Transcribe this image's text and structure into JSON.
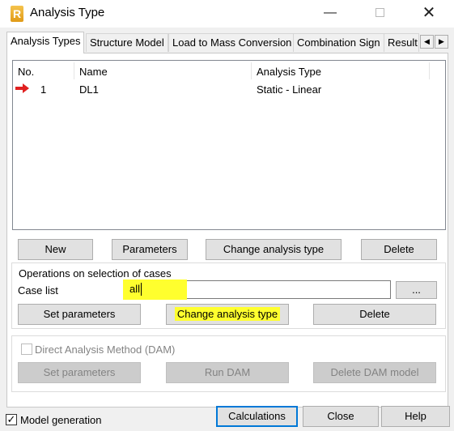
{
  "window": {
    "title": "Analysis Type",
    "app_icon_letter": "R",
    "minimize_glyph": "—",
    "close_glyph": "✕"
  },
  "tabs": [
    {
      "label": "Analysis Types",
      "active": true
    },
    {
      "label": "Structure Model",
      "active": false
    },
    {
      "label": "Load to Mass Conversion",
      "active": false
    },
    {
      "label": "Combination Sign",
      "active": false
    },
    {
      "label": "Result",
      "active": false
    }
  ],
  "tab_scroll": {
    "left": "◀",
    "right": "▶"
  },
  "cases_table": {
    "columns": [
      "No.",
      "Name",
      "Analysis Type"
    ],
    "rows": [
      {
        "marker": "red-arrow-icon",
        "no": "1",
        "name": "DL1",
        "analysis_type": "Static - Linear"
      }
    ]
  },
  "case_buttons": {
    "new": "New",
    "parameters": "Parameters",
    "change_analysis_type": "Change analysis type",
    "delete": "Delete"
  },
  "operations": {
    "group_label": "Operations on selection of cases",
    "case_list_label": "Case list",
    "case_list_value": "all",
    "browse_label": "...",
    "set_parameters": "Set parameters",
    "change_analysis_type": "Change analysis type",
    "delete": "Delete"
  },
  "dam": {
    "checkbox_label": "Direct Analysis Method (DAM)",
    "checked": false,
    "set_parameters": "Set parameters",
    "run_dam": "Run DAM",
    "delete_dam_model": "Delete DAM model"
  },
  "footer": {
    "model_generation_label": "Model generation",
    "model_generation_checked": true,
    "calculations": "Calculations",
    "close": "Close",
    "help": "Help"
  },
  "colors": {
    "highlight": "#ffff2e",
    "arrow": "#e02020",
    "focus_border": "#0078d7"
  }
}
